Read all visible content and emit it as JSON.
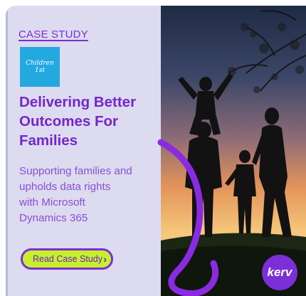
{
  "case_study": {
    "label": "CASE STUDY"
  },
  "logo": {
    "text": "Children 1st"
  },
  "headline": {
    "line1": "Delivering Better",
    "line2": "Outcomes For",
    "line3": "Families"
  },
  "subtext": {
    "line1": "Supporting families and",
    "line2": "upholds data rights",
    "line3": "with Microsoft",
    "line4": "Dynamics 365"
  },
  "cta": {
    "label": "Read Case Study",
    "chevron": "›"
  },
  "brand": {
    "text": "kerv"
  },
  "colors": {
    "panel": "#dcdbef",
    "accent_purple": "#7b2fd6",
    "lime": "#c8ef2d",
    "logo_blue": "#24a8e0"
  },
  "icons": {
    "button_icon": "chevron-right-icon",
    "brand_icon": "kerv-logo"
  }
}
